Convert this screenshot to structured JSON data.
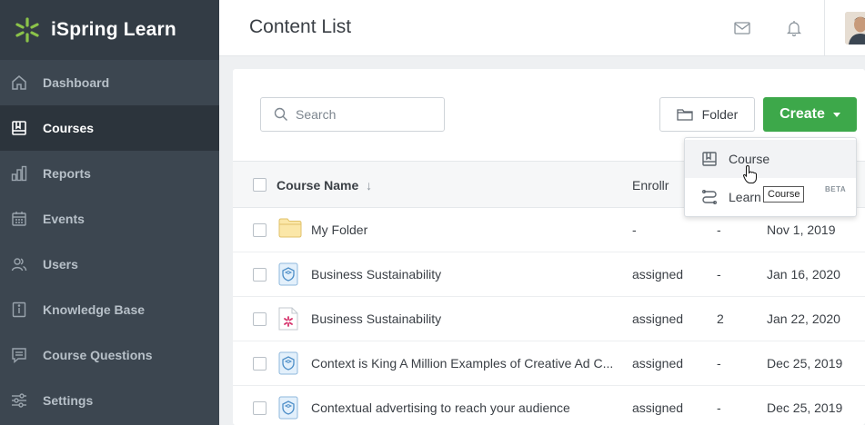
{
  "brand": {
    "name": "iSpring Learn"
  },
  "sidebar": {
    "items": [
      {
        "label": "Dashboard",
        "icon": "home-icon"
      },
      {
        "label": "Courses",
        "icon": "book-icon",
        "active": true
      },
      {
        "label": "Reports",
        "icon": "bar-chart-icon"
      },
      {
        "label": "Events",
        "icon": "calendar-icon"
      },
      {
        "label": "Users",
        "icon": "users-icon"
      },
      {
        "label": "Knowledge Base",
        "icon": "knowledge-base-icon"
      },
      {
        "label": "Course Questions",
        "icon": "chat-icon"
      },
      {
        "label": "Settings",
        "icon": "sliders-icon"
      }
    ]
  },
  "header": {
    "title": "Content List"
  },
  "toolbar": {
    "search_placeholder": "Search",
    "folder_label": "Folder",
    "create_label": "Create"
  },
  "table": {
    "columns": {
      "name": "Course Name",
      "enrollment": "Enrollr"
    },
    "rows": [
      {
        "name": "My Folder",
        "type": "folder",
        "enrollment": "-",
        "count": "-",
        "date": "Nov 1, 2019"
      },
      {
        "name": "Business Sustainability",
        "type": "course",
        "enrollment": "assigned",
        "count": "-",
        "date": "Jan 16, 2020"
      },
      {
        "name": "Business Sustainability",
        "type": "ispring-file",
        "enrollment": "assigned",
        "count": "2",
        "date": "Jan 22, 2020"
      },
      {
        "name": "Context is King A Million Examples of Creative Ad C...",
        "type": "course",
        "enrollment": "assigned",
        "count": "-",
        "date": "Dec 25, 2019"
      },
      {
        "name": "Contextual advertising to reach your audience",
        "type": "course",
        "enrollment": "assigned",
        "count": "-",
        "date": "Dec 25, 2019"
      }
    ]
  },
  "create_menu": {
    "items": [
      {
        "label": "Course",
        "icon": "book-icon"
      },
      {
        "label": "Learn",
        "label_tail": "k",
        "badge": "BETA",
        "icon": "path-icon"
      }
    ],
    "tooltip": "Course"
  },
  "colors": {
    "accent": "#3da84a",
    "sidebar": "#3c4650",
    "brand_green": "#8bc34a"
  }
}
